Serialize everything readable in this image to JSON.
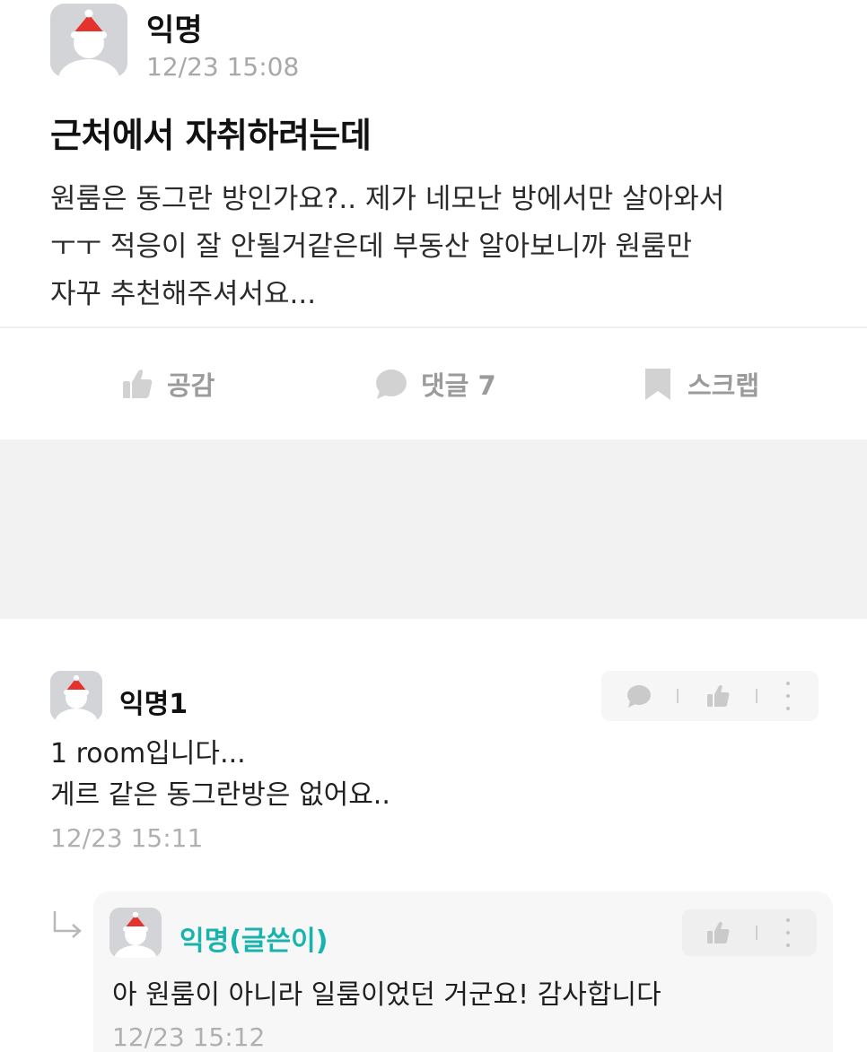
{
  "post": {
    "author": "익명",
    "time": "12/23 15:08",
    "title": "근처에서 자취하려는데",
    "body_lines": [
      "원룸은 동그란 방인가요?.. 제가 네모난 방에서만 살아와서",
      "ㅜㅜ 적응이 잘 안될거같은데 부동산 알아보니까 원룸만",
      "자꾸 추천해주셔서요..."
    ]
  },
  "actions": {
    "like": "공감",
    "comment": "댓글 7",
    "scrap": "스크랩"
  },
  "comments": [
    {
      "author": "익명1",
      "lines": [
        "1 room입니다...",
        "게르 같은 동그란방은 없어요.."
      ],
      "time": "12/23 15:11"
    }
  ],
  "reply": {
    "author": "익명(글쓴이)",
    "text": "아 원룸이 아니라 일룸이었던 거군요! 감사합니다",
    "time": "12/23 15:12"
  },
  "colors": {
    "writer_accent": "#19b3ad",
    "muted_text": "#a8a8a8",
    "avatar_bg": "#d3d4d8",
    "hat_red": "#e5322d"
  },
  "icons": {
    "avatar": "snowman-santa-hat-icon",
    "like": "thumbs-up-icon",
    "comment": "speech-bubble-icon",
    "scrap": "bookmark-icon",
    "more": "vertical-dots-icon",
    "reply": "reply-arrow-icon"
  }
}
